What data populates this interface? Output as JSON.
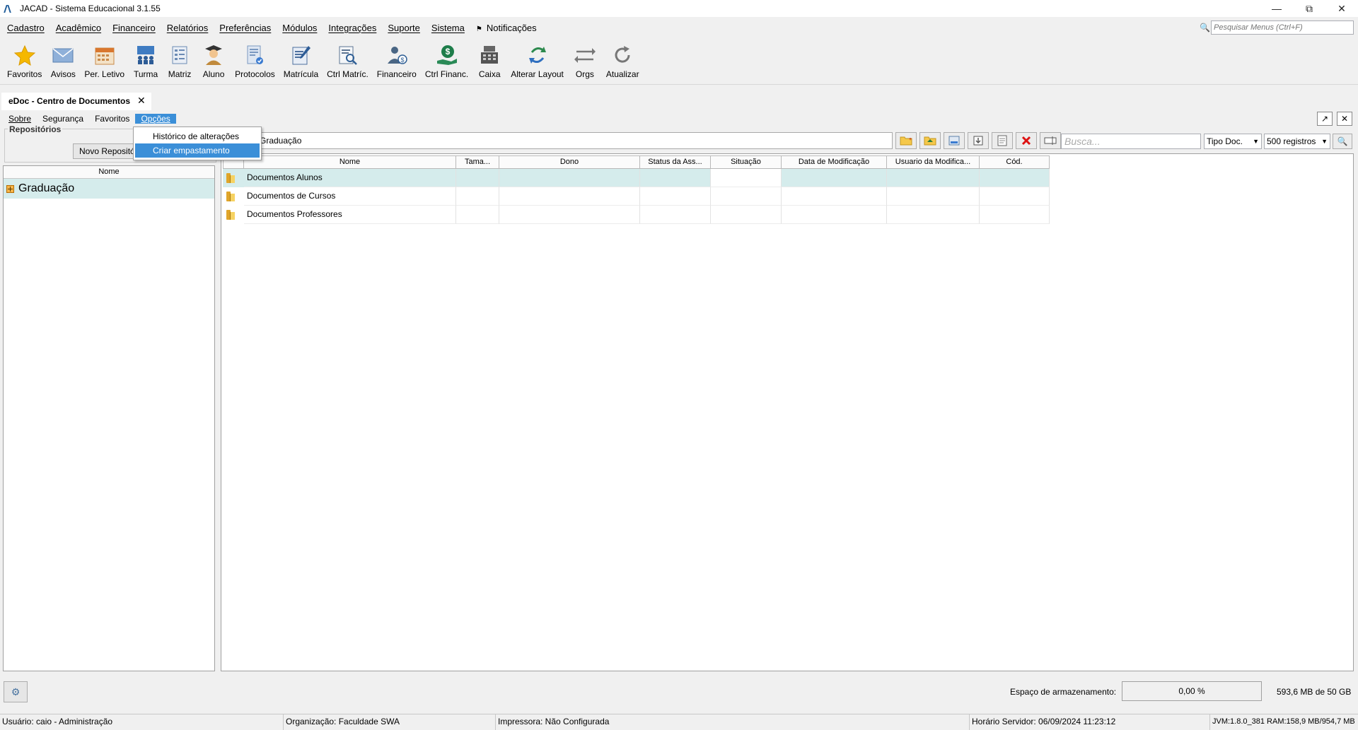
{
  "window": {
    "title": "JACAD - Sistema Educacional 3.1.55",
    "controls": [
      "minimize-icon",
      "restore-icon",
      "close-icon"
    ]
  },
  "menubar": {
    "items": [
      "Cadastro",
      "Acadêmico",
      "Financeiro",
      "Relatórios",
      "Preferências",
      "Módulos",
      "Integrações",
      "Suporte",
      "Sistema"
    ],
    "notifications": "Notificações",
    "search_placeholder": "Pesquisar Menus (Ctrl+F)"
  },
  "toolbar": {
    "items": [
      {
        "label": "Favoritos",
        "icon": "star-icon"
      },
      {
        "label": "Avisos",
        "icon": "envelope-icon"
      },
      {
        "label": "Per. Letivo",
        "icon": "calendar-icon"
      },
      {
        "label": "Turma",
        "icon": "class-icon"
      },
      {
        "label": "Matriz",
        "icon": "matrix-icon"
      },
      {
        "label": "Aluno",
        "icon": "student-icon"
      },
      {
        "label": "Protocolos",
        "icon": "protocol-icon"
      },
      {
        "label": "Matrícula",
        "icon": "enrollment-icon"
      },
      {
        "label": "Ctrl Matríc.",
        "icon": "enrollment-control-icon"
      },
      {
        "label": "Financeiro",
        "icon": "finance-person-icon"
      },
      {
        "label": "Ctrl Financ.",
        "icon": "money-hand-icon"
      },
      {
        "label": "Caixa",
        "icon": "cash-register-icon"
      },
      {
        "label": "Alterar Layout",
        "icon": "change-layout-icon"
      },
      {
        "label": "Orgs",
        "icon": "swap-arrows-icon"
      },
      {
        "label": "Atualizar",
        "icon": "refresh-icon"
      }
    ]
  },
  "document_tab": {
    "title": "eDoc - Centro de Documentos"
  },
  "inner_menu": {
    "items": [
      "Sobre",
      "Segurança",
      "Favoritos",
      "Opções"
    ],
    "active": "Opções"
  },
  "options_dropdown": {
    "items": [
      "Histórico de alterações",
      "Criar empastamento"
    ],
    "highlighted": "Criar empastamento"
  },
  "left_panel": {
    "group_label": "Repositórios",
    "new_button": "Novo Repositório",
    "column_header": "Nome",
    "rows": [
      "Graduação"
    ]
  },
  "right_panel": {
    "path": "Graduação",
    "search_placeholder": "Busca...",
    "doc_type": "Tipo Doc.",
    "records": "500 registros",
    "columns": [
      "Nome",
      "Tama...",
      "Dono",
      "Status da Ass...",
      "Situação",
      "Data de Modificação",
      "Usuario da Modifica...",
      "Cód."
    ],
    "rows": [
      {
        "name": "Documentos Alunos",
        "selected": true
      },
      {
        "name": "Documentos de Cursos",
        "selected": false
      },
      {
        "name": "Documentos Professores",
        "selected": false
      }
    ]
  },
  "storage": {
    "label": "Espaço de armazenamento:",
    "percent": "0,00 %",
    "used": "593,6 MB  de 50 GB"
  },
  "statusbar": {
    "user": "Usuário: caio - Administração",
    "org": "Organização: Faculdade SWA",
    "printer": "Impressora: Não Configurada",
    "server_time": "Horário Servidor: 06/09/2024 11:23:12",
    "jvm": "JVM:1.8.0_381  RAM:158,9 MB/954,7 MB"
  }
}
